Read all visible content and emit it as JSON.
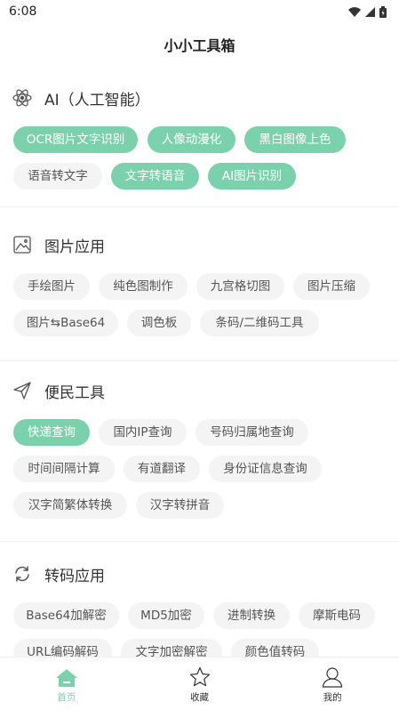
{
  "status_bar": {
    "time": "6:08"
  },
  "app": {
    "title": "小小工具箱"
  },
  "sections": [
    {
      "title": "AI（人工智能）",
      "icon": "atom-icon",
      "chips": [
        {
          "label": "OCR图片文字识别",
          "active": true
        },
        {
          "label": "人像动漫化",
          "active": true
        },
        {
          "label": "黑白图像上色",
          "active": true
        },
        {
          "label": "语音转文字",
          "active": false
        },
        {
          "label": "文字转语音",
          "active": true
        },
        {
          "label": "AI图片识别",
          "active": true
        }
      ]
    },
    {
      "title": "图片应用",
      "icon": "image-icon",
      "chips": [
        {
          "label": "手绘图片",
          "active": false
        },
        {
          "label": "纯色图制作",
          "active": false
        },
        {
          "label": "九宫格切图",
          "active": false
        },
        {
          "label": "图片压缩",
          "active": false
        },
        {
          "label": "图片⇆Base64",
          "active": false
        },
        {
          "label": "调色板",
          "active": false
        },
        {
          "label": "条码/二维码工具",
          "active": false
        }
      ]
    },
    {
      "title": "便民工具",
      "icon": "paper-plane-icon",
      "chips": [
        {
          "label": "快递查询",
          "active": true
        },
        {
          "label": "国内IP查询",
          "active": false
        },
        {
          "label": "号码归属地查询",
          "active": false
        },
        {
          "label": "时间间隔计算",
          "active": false
        },
        {
          "label": "有道翻译",
          "active": false
        },
        {
          "label": "身份证信息查询",
          "active": false
        },
        {
          "label": "汉字简繁体转换",
          "active": false
        },
        {
          "label": "汉字转拼音",
          "active": false
        }
      ]
    },
    {
      "title": "转码应用",
      "icon": "refresh-icon",
      "chips": [
        {
          "label": "Base64加解密",
          "active": false
        },
        {
          "label": "MD5加密",
          "active": false
        },
        {
          "label": "进制转换",
          "active": false
        },
        {
          "label": "摩斯电码",
          "active": false
        },
        {
          "label": "URL编码解码",
          "active": false
        },
        {
          "label": "文字加密解密",
          "active": false
        },
        {
          "label": "颜色值转码",
          "active": false
        }
      ]
    }
  ],
  "bottom_nav": [
    {
      "label": "首页",
      "icon": "home-icon",
      "active": true
    },
    {
      "label": "收藏",
      "icon": "star-icon",
      "active": false
    },
    {
      "label": "我的",
      "icon": "user-icon",
      "active": false
    }
  ],
  "colors": {
    "accent": "#7cd1ad",
    "chip_bg": "#f3f4f3",
    "text": "#333333"
  }
}
